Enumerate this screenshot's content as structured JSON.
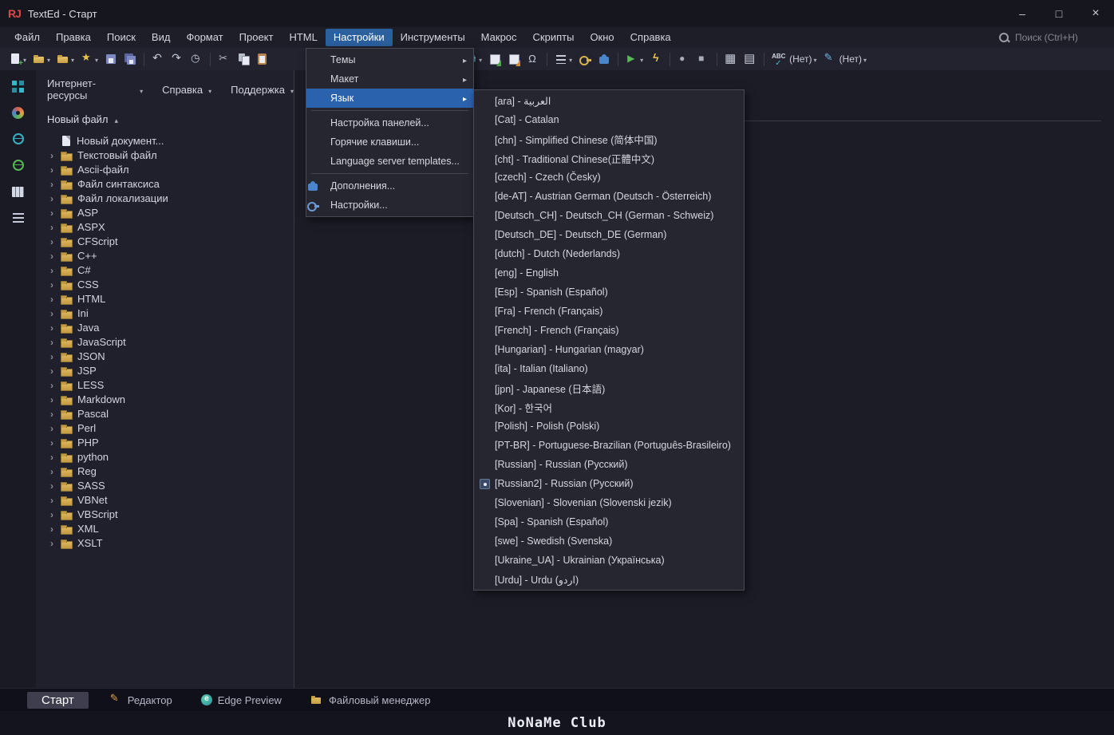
{
  "window": {
    "title": "TextEd - Старт",
    "logo": "RJ",
    "controls": {
      "minimize": "–",
      "maximize": "□",
      "close": "×"
    }
  },
  "colors": {
    "accent_blue": "#2b62ae",
    "menubar_highlight": "#2b5f9e",
    "folder_yellow": "#d4ab52",
    "active_tab_bg": "#3e3e4f"
  },
  "menubar": {
    "search_placeholder": "Поиск (Ctrl+H)",
    "items": [
      {
        "id": "file",
        "label": "Файл"
      },
      {
        "id": "edit",
        "label": "Правка"
      },
      {
        "id": "find",
        "label": "Поиск"
      },
      {
        "id": "view",
        "label": "Вид"
      },
      {
        "id": "format",
        "label": "Формат"
      },
      {
        "id": "project",
        "label": "Проект"
      },
      {
        "id": "html",
        "label": "HTML"
      },
      {
        "id": "settings",
        "label": "Настройки",
        "active": true
      },
      {
        "id": "tools",
        "label": "Инструменты"
      },
      {
        "id": "macro",
        "label": "Макрос"
      },
      {
        "id": "scripts",
        "label": "Скрипты"
      },
      {
        "id": "window",
        "label": "Окно"
      },
      {
        "id": "help",
        "label": "Справка"
      }
    ]
  },
  "toolbar": {
    "items": [
      {
        "id": "new-file",
        "cls": "ic-newfile",
        "caret": true
      },
      {
        "id": "open-file",
        "cls": "ic-open",
        "caret": true
      },
      {
        "id": "open-recent",
        "cls": "ic-open2",
        "caret": true
      },
      {
        "id": "favorites",
        "cls": "ic-star",
        "caret": true
      },
      {
        "id": "save",
        "cls": "ic-save"
      },
      {
        "id": "save-all",
        "cls": "ic-saveall"
      },
      {
        "sep": true
      },
      {
        "id": "undo",
        "cls": "ic-undo"
      },
      {
        "id": "redo",
        "cls": "ic-redo"
      },
      {
        "id": "history",
        "cls": "ic-clock"
      },
      {
        "sep": true
      },
      {
        "id": "cut",
        "cls": "ic-cut"
      },
      {
        "id": "copy",
        "cls": "ic-copy"
      },
      {
        "id": "paste",
        "cls": "ic-paste"
      },
      {
        "gap": 235
      },
      {
        "id": "browser-preview",
        "cls": "ic-globe",
        "caret": true
      },
      {
        "id": "export-page",
        "cls": "ic-export"
      },
      {
        "id": "import-page",
        "cls": "ic-export2"
      },
      {
        "id": "special-chars",
        "cls": "ic-omega"
      },
      {
        "sep": true
      },
      {
        "id": "text-format",
        "cls": "ic-textblock",
        "caret": true
      },
      {
        "id": "key-tool",
        "cls": "ic-key"
      },
      {
        "id": "plugins",
        "cls": "ic-puzzle"
      },
      {
        "sep": true
      },
      {
        "id": "run",
        "cls": "ic-play",
        "caret": true
      },
      {
        "id": "quick-run",
        "cls": "ic-bolt"
      },
      {
        "sep": true
      },
      {
        "id": "record-macro",
        "cls": "ic-record"
      },
      {
        "id": "stop-macro",
        "cls": "ic-stop"
      },
      {
        "sep": true
      },
      {
        "id": "insert-table",
        "cls": "ic-table"
      },
      {
        "id": "table-tools",
        "cls": "ic-table2"
      },
      {
        "sep": true
      },
      {
        "id": "spellcheck",
        "cls": "ic-abc",
        "label": "(Нет)",
        "caret": true
      },
      {
        "id": "highlight-style",
        "cls": "ic-pen",
        "label": "(Нет)",
        "caret": true
      }
    ]
  },
  "iconstrip": [
    {
      "id": "dashboard",
      "cls": "ic-grid4"
    },
    {
      "id": "theme-colors",
      "cls": "ic-palette"
    },
    {
      "id": "web-resources",
      "cls": "ic-globe-teal"
    },
    {
      "id": "web-publish",
      "cls": "ic-globe-green"
    },
    {
      "id": "layout-columns",
      "cls": "ic-columns"
    },
    {
      "id": "notes-list",
      "cls": "ic-notes"
    }
  ],
  "panel": {
    "tabs": [
      {
        "id": "internet-resources",
        "label": "Интернет-ресурсы"
      },
      {
        "id": "help",
        "label": "Справка"
      },
      {
        "id": "support",
        "label": "Поддержка"
      }
    ],
    "header": "Новый файл",
    "tree": [
      {
        "label": "Новый документ...",
        "icon": "doc",
        "chevron": false
      },
      {
        "label": "Текстовый файл",
        "icon": "folder",
        "chevron": true
      },
      {
        "label": "Ascii-файл",
        "icon": "folder",
        "chevron": true
      },
      {
        "label": "Файл синтаксиса",
        "icon": "folder",
        "chevron": true
      },
      {
        "label": "Файл локализации",
        "icon": "folder",
        "chevron": true
      },
      {
        "label": "ASP",
        "icon": "folder",
        "chevron": true
      },
      {
        "label": "ASPX",
        "icon": "folder",
        "chevron": true
      },
      {
        "label": "CFScript",
        "icon": "folder",
        "chevron": true
      },
      {
        "label": "C++",
        "icon": "folder",
        "chevron": true
      },
      {
        "label": "C#",
        "icon": "folder",
        "chevron": true
      },
      {
        "label": "CSS",
        "icon": "folder",
        "chevron": true
      },
      {
        "label": "HTML",
        "icon": "folder",
        "chevron": true
      },
      {
        "label": "Ini",
        "icon": "folder",
        "chevron": true
      },
      {
        "label": "Java",
        "icon": "folder",
        "chevron": true
      },
      {
        "label": "JavaScript",
        "icon": "folder",
        "chevron": true
      },
      {
        "label": "JSON",
        "icon": "folder",
        "chevron": true
      },
      {
        "label": "JSP",
        "icon": "folder",
        "chevron": true
      },
      {
        "label": "LESS",
        "icon": "folder",
        "chevron": true
      },
      {
        "label": "Markdown",
        "icon": "folder",
        "chevron": true
      },
      {
        "label": "Pascal",
        "icon": "folder",
        "chevron": true
      },
      {
        "label": "Perl",
        "icon": "folder",
        "chevron": true
      },
      {
        "label": "PHP",
        "icon": "folder",
        "chevron": true
      },
      {
        "label": "python",
        "icon": "folder",
        "chevron": true
      },
      {
        "label": "Reg",
        "icon": "folder",
        "chevron": true
      },
      {
        "label": "SASS",
        "icon": "folder",
        "chevron": true
      },
      {
        "label": "VBNet",
        "icon": "folder",
        "chevron": true
      },
      {
        "label": "VBScript",
        "icon": "folder",
        "chevron": true
      },
      {
        "label": "XML",
        "icon": "folder",
        "chevron": true
      },
      {
        "label": "XSLT",
        "icon": "folder",
        "chevron": true
      }
    ]
  },
  "settings_menu": {
    "items": [
      {
        "id": "themes",
        "label": "Темы",
        "arrow": true
      },
      {
        "id": "layout",
        "label": "Макет",
        "arrow": true
      },
      {
        "id": "language",
        "label": "Язык",
        "arrow": true,
        "active": true
      },
      {
        "sep": true
      },
      {
        "id": "panels",
        "label": "Настройка панелей..."
      },
      {
        "id": "hotkeys",
        "label": "Горячие клавиши..."
      },
      {
        "id": "lang-server",
        "label": "Language server templates..."
      },
      {
        "sep": true
      },
      {
        "id": "addons",
        "label": "Дополнения...",
        "icon": "ic-puzzle"
      },
      {
        "id": "options",
        "label": "Настройки...",
        "icon": "ic-key-blue"
      }
    ]
  },
  "language_menu": {
    "items": [
      {
        "label": "[ara] - العربية"
      },
      {
        "label": "[Cat] - Catalan"
      },
      {
        "label": "[chn] - Simplified Chinese (简体中国)"
      },
      {
        "label": "[cht] - Traditional Chinese(正體中文)"
      },
      {
        "label": "[czech] - Czech (Česky)"
      },
      {
        "label": "[de-AT] - Austrian German (Deutsch - Österreich)"
      },
      {
        "label": "[Deutsch_CH] - Deutsch_CH (German - Schweiz)"
      },
      {
        "label": "[Deutsch_DE] - Deutsch_DE (German)"
      },
      {
        "label": "[dutch] - Dutch (Nederlands)"
      },
      {
        "label": "[eng] - English"
      },
      {
        "label": "[Esp] - Spanish (Español)"
      },
      {
        "label": "[Fra] - French (Français)"
      },
      {
        "label": "[French] - French (Français)"
      },
      {
        "label": "[Hungarian] - Hungarian (magyar)"
      },
      {
        "label": "[ita] - Italian (Italiano)"
      },
      {
        "label": "[jpn] - Japanese (日本語)"
      },
      {
        "label": "[Kor] - 한국어"
      },
      {
        "label": "[Polish] - Polish (Polski)"
      },
      {
        "label": "[PT-BR] - Portuguese-Brazilian (Português-Brasileiro)"
      },
      {
        "label": "[Russian] - Russian (Русский)"
      },
      {
        "label": "[Russian2] - Russian (Русский)",
        "selected": true
      },
      {
        "label": "[Slovenian] - Slovenian (Slovenski jezik)"
      },
      {
        "label": "[Spa] - Spanish (Español)"
      },
      {
        "label": "[swe] - Swedish (Svenska)"
      },
      {
        "label": "[Ukraine_UA] - Ukrainian (Українська)"
      },
      {
        "label": "[Urdu] - Urdu (اردو)"
      }
    ]
  },
  "bottombar": {
    "tabs": [
      {
        "id": "start",
        "label": "Старт",
        "active": true
      },
      {
        "id": "editor",
        "label": "Редактор",
        "icon": "ic-pencil"
      },
      {
        "id": "edge-preview",
        "label": "Edge Preview",
        "icon": "ic-edge"
      },
      {
        "id": "file-manager",
        "label": "Файловый менеджер",
        "icon": "ic-filemgr"
      }
    ]
  },
  "watermark": "NoNaMe Club"
}
